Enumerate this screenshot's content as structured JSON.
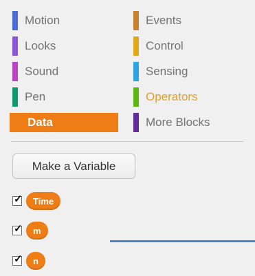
{
  "categories": [
    {
      "label": "Motion",
      "color": "#4a6cd4"
    },
    {
      "label": "Events",
      "color": "#c88330"
    },
    {
      "label": "Looks",
      "color": "#8a55d7"
    },
    {
      "label": "Control",
      "color": "#e1a91a"
    },
    {
      "label": "Sound",
      "color": "#bb42c3"
    },
    {
      "label": "Sensing",
      "color": "#2ca5e2"
    },
    {
      "label": "Pen",
      "color": "#0e9a6c"
    },
    {
      "label": "Operators",
      "color": "#5cb712"
    },
    {
      "label": "Data",
      "color": "#ee7d16"
    },
    {
      "label": "More Blocks",
      "color": "#632d99"
    }
  ],
  "selected_category": "Data",
  "make_variable_label": "Make a Variable",
  "variables": [
    {
      "name": "Time",
      "checked": true
    },
    {
      "name": "m",
      "checked": true
    },
    {
      "name": "n",
      "checked": true
    }
  ]
}
